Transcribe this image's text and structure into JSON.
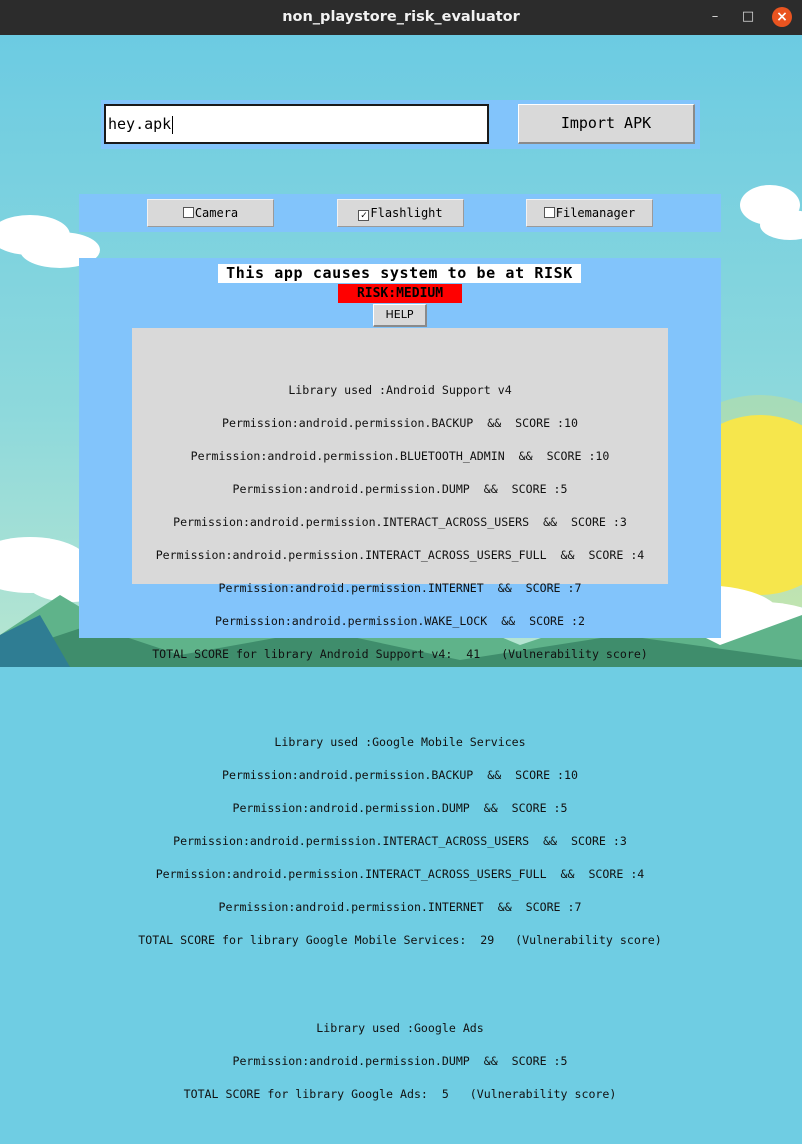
{
  "window": {
    "title": "non_playstore_risk_evaluator",
    "minimize_glyph": "–",
    "maximize_glyph": "□",
    "close_glyph": "×"
  },
  "import": {
    "file_value": "hey.apk",
    "button_label": "Import APK"
  },
  "checkboxes": [
    {
      "label": "Camera",
      "checked": false,
      "mark": ""
    },
    {
      "label": "Flashlight",
      "checked": true,
      "mark": "✓"
    },
    {
      "label": "Filemanager",
      "checked": false,
      "mark": ""
    }
  ],
  "result": {
    "headline": "This app causes system to be at RISK",
    "risk_level": "RISK:MEDIUM",
    "risk_color": "#ff0000",
    "help_label": "HELP"
  },
  "libraries": [
    {
      "header": "Library used :Android Support v4",
      "permissions": [
        "Permission:android.permission.BACKUP  &&  SCORE :10",
        "Permission:android.permission.BLUETOOTH_ADMIN  &&  SCORE :10",
        "Permission:android.permission.DUMP  &&  SCORE :5",
        "Permission:android.permission.INTERACT_ACROSS_USERS  &&  SCORE :3",
        "Permission:android.permission.INTERACT_ACROSS_USERS_FULL  &&  SCORE :4",
        "Permission:android.permission.INTERNET  &&  SCORE :7",
        "Permission:android.permission.WAKE_LOCK  &&  SCORE :2"
      ],
      "total": "TOTAL SCORE for library Android Support v4:  41   (Vulnerability score)"
    },
    {
      "header": "Library used :Google Mobile Services",
      "permissions": [
        "Permission:android.permission.BACKUP  &&  SCORE :10",
        "Permission:android.permission.DUMP  &&  SCORE :5",
        "Permission:android.permission.INTERACT_ACROSS_USERS  &&  SCORE :3",
        "Permission:android.permission.INTERACT_ACROSS_USERS_FULL  &&  SCORE :4",
        "Permission:android.permission.INTERNET  &&  SCORE :7"
      ],
      "total": "TOTAL SCORE for library Google Mobile Services:  29   (Vulnerability score)"
    },
    {
      "header": "Library used :Google Ads",
      "permissions": [
        "Permission:android.permission.DUMP  &&  SCORE :5"
      ],
      "total": "TOTAL SCORE for library Google Ads:  5   (Vulnerability score)"
    }
  ],
  "colors": {
    "titlebar": "#2c2c2c",
    "panel": "#82c4fb",
    "sky": "#6fcde3",
    "close_button": "#e95420"
  }
}
